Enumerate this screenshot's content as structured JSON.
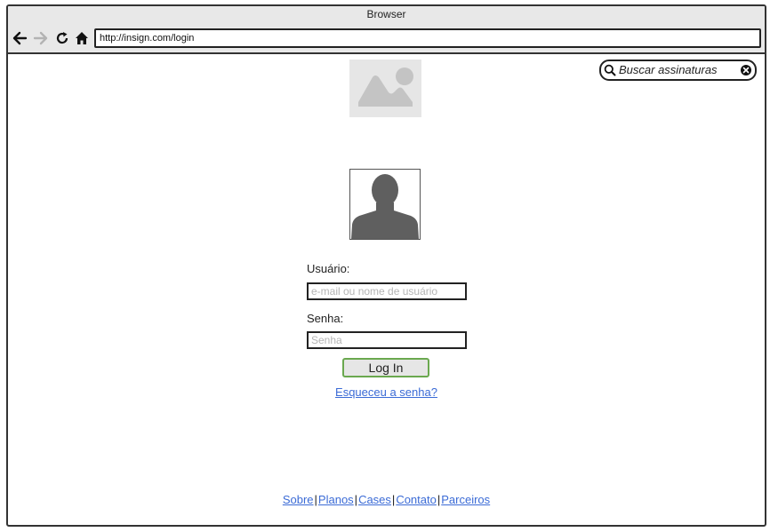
{
  "window": {
    "title": "Browser",
    "url": "http://insign.com/login"
  },
  "icons": {
    "back": "arrow-left-icon",
    "forward": "arrow-right-icon",
    "reload": "reload-icon",
    "home": "home-icon",
    "search": "search-icon",
    "clear": "close-circle-icon",
    "image": "image-placeholder-icon",
    "user": "user-silhouette-icon"
  },
  "search": {
    "text": "Buscar assinaturas"
  },
  "login": {
    "username_label": "Usuário:",
    "username_placeholder": "e-mail ou nome de usuário",
    "password_label": "Senha:",
    "password_placeholder": "Senha",
    "button_label": "Log In",
    "forgot_label": "Esqueceu a senha?"
  },
  "footer": {
    "links": [
      "Sobre",
      "Planos",
      "Cases",
      "Contato",
      "Parceiros"
    ],
    "separator": "|"
  },
  "colors": {
    "link": "#3b6bd6",
    "button_border": "#6aa84f",
    "forward_disabled": "#b3b3b3"
  }
}
